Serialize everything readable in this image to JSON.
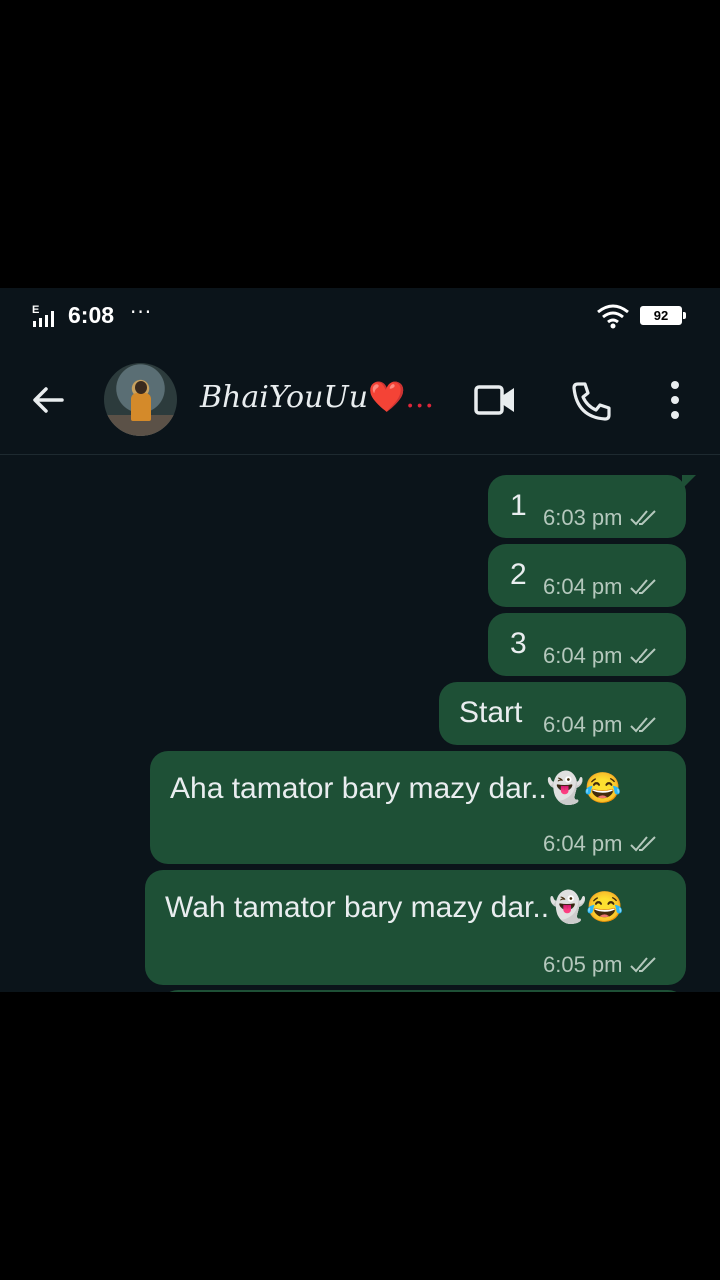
{
  "status_bar": {
    "network_type": "E",
    "time": "6:08",
    "more_dots": "···",
    "battery": "92"
  },
  "header": {
    "contact_name": "BhaiYouUu",
    "name_suffix": "❤️...",
    "back_icon": "arrow-left-icon",
    "video_icon": "video-camera-icon",
    "call_icon": "phone-icon",
    "menu_icon": "more-vertical-icon"
  },
  "messages": [
    {
      "text": "1",
      "time": "6:03 pm",
      "status": "read"
    },
    {
      "text": "2",
      "time": "6:04 pm",
      "status": "read"
    },
    {
      "text": "3",
      "time": "6:04 pm",
      "status": "read"
    },
    {
      "text": "Start",
      "time": "6:04 pm",
      "status": "read"
    },
    {
      "text": "Aha tamator bary mazy dar..👻😂",
      "time": "6:04 pm",
      "status": "read"
    },
    {
      "text": "Wah tamator bary mazy dar..👻😂",
      "time": "6:05 pm",
      "status": "read"
    }
  ],
  "colors": {
    "background": "#0b141a",
    "outgoing_bubble": "#1e5036",
    "heart": "#e0263a"
  }
}
